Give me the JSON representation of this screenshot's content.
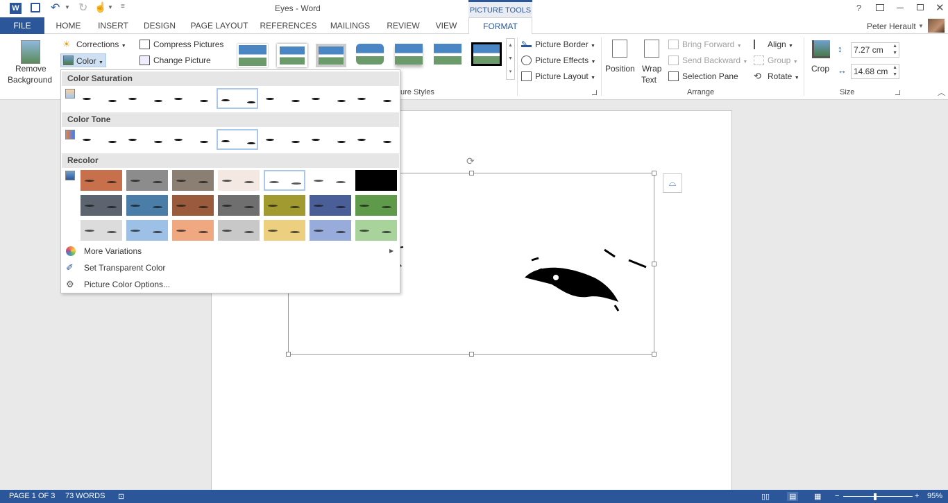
{
  "window": {
    "title": "Eyes - Word",
    "context_tab": "PICTURE TOOLS"
  },
  "tabs": [
    "FILE",
    "HOME",
    "INSERT",
    "DESIGN",
    "PAGE LAYOUT",
    "REFERENCES",
    "MAILINGS",
    "REVIEW",
    "VIEW",
    "FORMAT"
  ],
  "user": {
    "name": "Peter Herault"
  },
  "ribbon": {
    "adjust": {
      "remove_bg_line1": "Remove",
      "remove_bg_line2": "Background",
      "corrections": "Corrections",
      "color": "Color",
      "compress": "Compress Pictures",
      "change": "Change Picture"
    },
    "styles": {
      "label": "ure Styles"
    },
    "picture_options": {
      "border": "Picture Border",
      "effects": "Picture Effects",
      "layout": "Picture Layout"
    },
    "arrange": {
      "position": "Position",
      "wrap_line1": "Wrap",
      "wrap_line2": "Text",
      "bring_forward": "Bring Forward",
      "send_backward": "Send Backward",
      "selection_pane": "Selection Pane",
      "align": "Align",
      "group": "Group",
      "rotate": "Rotate",
      "label": "Arrange"
    },
    "size": {
      "crop": "Crop",
      "height": "7.27 cm",
      "width": "14.68 cm",
      "label": "Size"
    }
  },
  "color_menu": {
    "saturation": "Color Saturation",
    "tone": "Color Tone",
    "recolor": "Recolor",
    "more_variations": "More Variations",
    "set_transparent": "Set Transparent Color",
    "options": "Picture Color Options...",
    "recolor_colors": [
      [
        "#c8704c",
        "#8c8c8c",
        "#8a7f72",
        "#f4e9e2",
        "#ffffff",
        "#ffffff",
        "#000000"
      ],
      [
        "#5c6470",
        "#4a7ea8",
        "#9a5a3c",
        "#6f6f6f",
        "#a09a30",
        "#4a5f98",
        "#5f9a4a"
      ],
      [
        "#dcdcdc",
        "#9cc0e6",
        "#f0a880",
        "#c8c8c8",
        "#ecd080",
        "#98acdc",
        "#a8d49c"
      ]
    ]
  },
  "statusbar": {
    "page": "PAGE 1 OF 3",
    "words": "73 WORDS",
    "zoom": "95%"
  }
}
